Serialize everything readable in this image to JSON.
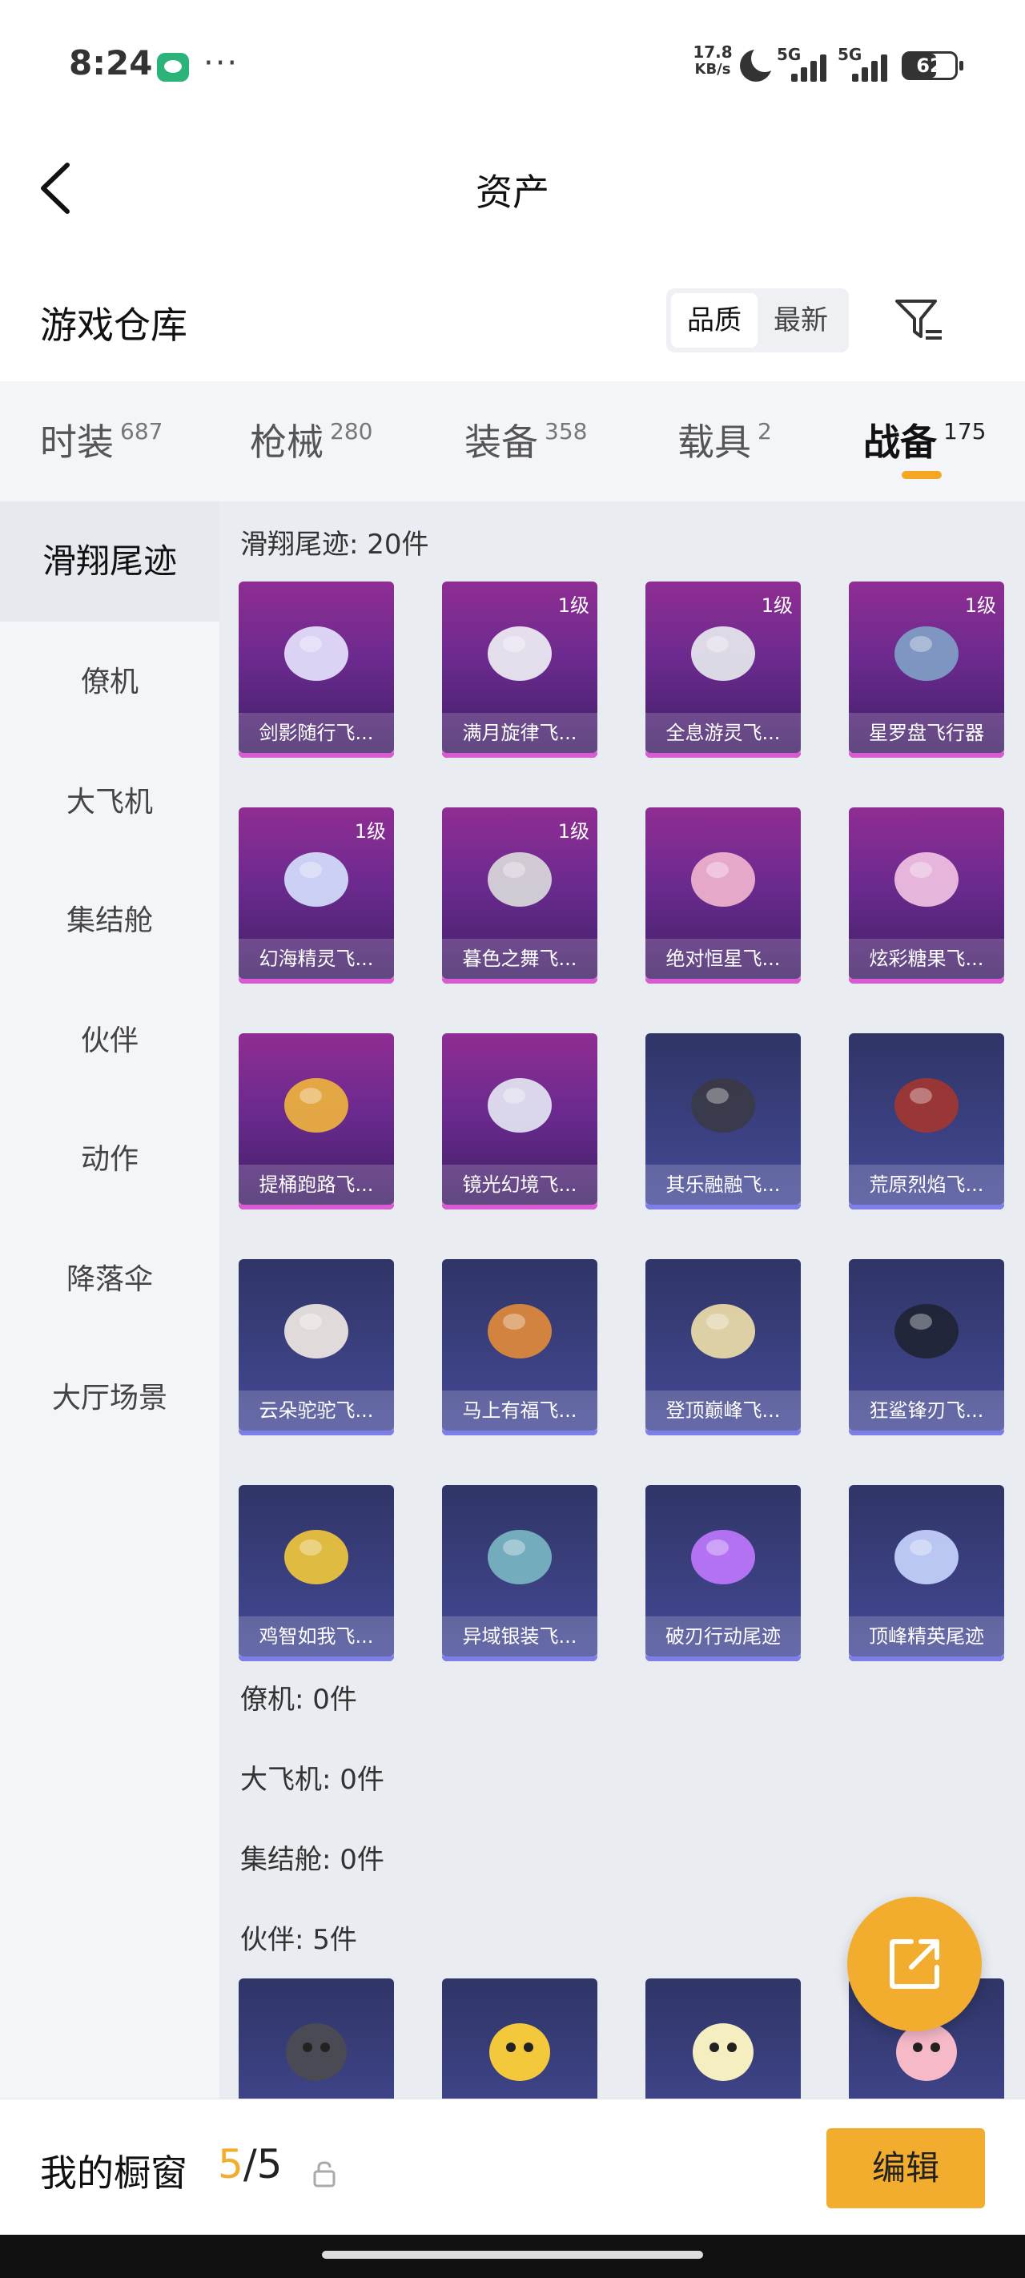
{
  "status": {
    "time": "8:24",
    "dots": "···",
    "speed_value": "17.8",
    "speed_unit": "KB/s",
    "signal1_label": "5G",
    "signal2_label": "5G",
    "battery": "62",
    "battery_level": 0.62
  },
  "header": {
    "title": "资产"
  },
  "warehouse": {
    "title": "游戏仓库",
    "sort_options": [
      "品质",
      "最新"
    ],
    "sort_active": "品质"
  },
  "tabs": [
    {
      "name": "时装",
      "count": "687"
    },
    {
      "name": "枪械",
      "count": "280"
    },
    {
      "name": "装备",
      "count": "358"
    },
    {
      "name": "载具",
      "count": "2"
    },
    {
      "name": "战备",
      "count": "175",
      "active": true
    }
  ],
  "sidenav": [
    "滑翔尾迹",
    "僚机",
    "大飞机",
    "集结舱",
    "伙伴",
    "动作",
    "降落伞",
    "大厅场景"
  ],
  "sections": {
    "glide_trail": "滑翔尾迹: 20件",
    "wingman": "僚机: 0件",
    "big_plane": "大飞机: 0件",
    "assembly_pod": "集结舱: 0件",
    "partner": "伙伴: 5件"
  },
  "items": [
    {
      "name": "剑影随行飞...",
      "level": "",
      "rarity": "purple",
      "color": "#e8e6ff"
    },
    {
      "name": "满月旋律飞...",
      "level": "1级",
      "rarity": "purple",
      "color": "#f2f2f6"
    },
    {
      "name": "全息游灵飞...",
      "level": "1级",
      "rarity": "purple",
      "color": "#e9ecef"
    },
    {
      "name": "星罗盘飞行器",
      "level": "1级",
      "rarity": "purple",
      "color": "#7fa2c6"
    },
    {
      "name": "幻海精灵飞...",
      "level": "1级",
      "rarity": "purple",
      "color": "#d6e2ff"
    },
    {
      "name": "暮色之舞飞...",
      "level": "1级",
      "rarity": "purple",
      "color": "#dcdcdc"
    },
    {
      "name": "绝对恒星飞...",
      "level": "",
      "rarity": "purple",
      "color": "#f3b6cf"
    },
    {
      "name": "炫彩糖果飞...",
      "level": "",
      "rarity": "purple",
      "color": "#f4c4e4"
    },
    {
      "name": "提桶跑路飞...",
      "level": "",
      "rarity": "purple",
      "color": "#f0b53c"
    },
    {
      "name": "镜光幻境飞...",
      "level": "",
      "rarity": "purple",
      "color": "#e7e9f5"
    },
    {
      "name": "其乐融融飞...",
      "level": "",
      "rarity": "blue",
      "color": "#3a3a46"
    },
    {
      "name": "荒原烈焰飞...",
      "level": "",
      "rarity": "blue",
      "color": "#a3362f"
    },
    {
      "name": "云朵驼驼飞...",
      "level": "",
      "rarity": "blue",
      "color": "#f3ebe6"
    },
    {
      "name": "马上有福飞...",
      "level": "",
      "rarity": "blue",
      "color": "#e38b3a"
    },
    {
      "name": "登顶巅峰飞...",
      "level": "",
      "rarity": "blue",
      "color": "#f0e0a8"
    },
    {
      "name": "狂鲨锋刃飞...",
      "level": "",
      "rarity": "blue",
      "color": "#1f2433"
    },
    {
      "name": "鸡智如我飞...",
      "level": "",
      "rarity": "blue",
      "color": "#f3c93b"
    },
    {
      "name": "异域银装飞...",
      "level": "",
      "rarity": "blue",
      "color": "#7ab9c4"
    },
    {
      "name": "破刃行动尾迹",
      "level": "",
      "rarity": "blue",
      "color": "#c078ff"
    },
    {
      "name": "顶峰精英尾迹",
      "level": "",
      "rarity": "blue",
      "color": "#c9d6ff"
    }
  ],
  "partner_items": [
    {
      "name": "",
      "rarity": "blue",
      "color": "#4a4a55"
    },
    {
      "name": "",
      "rarity": "blue",
      "color": "#f3c93b"
    },
    {
      "name": "",
      "rarity": "blue",
      "color": "#f5eec0"
    },
    {
      "name": "",
      "rarity": "blue",
      "color": "#f6b9c8"
    }
  ],
  "bottom": {
    "window_label": "我的橱窗",
    "current": "5",
    "separator_total": "/5",
    "edit": "编辑"
  },
  "accent": "#f2ad2e"
}
